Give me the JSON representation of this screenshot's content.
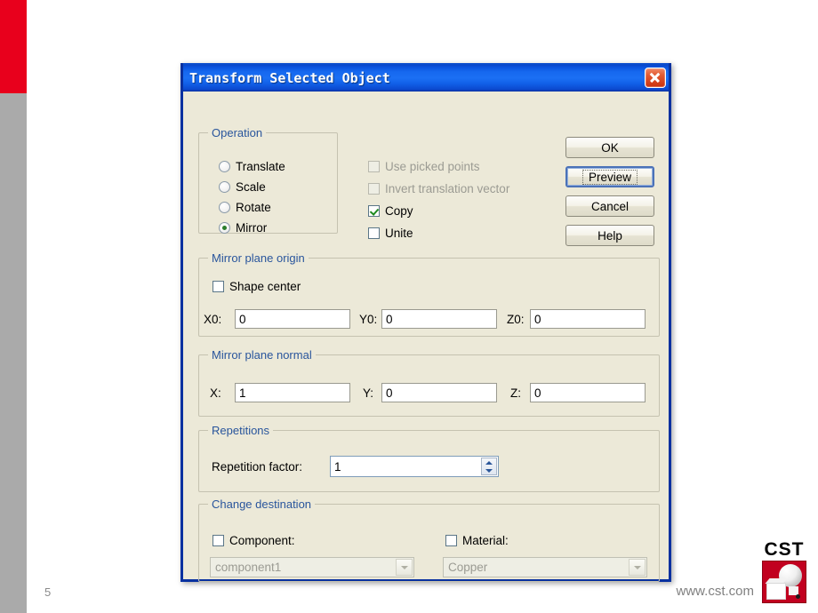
{
  "slide": {
    "page_number": "5",
    "url": "www.cst.com",
    "logo_word": "CST",
    "accent_red": "#e8001c",
    "accent_grey": "#aaaaaa"
  },
  "dialog": {
    "title": "Transform Selected Object",
    "close_label": "×",
    "titlebar_color": "#1b6ff4",
    "face_color": "#ece9d8",
    "group_label_color": "#29559c",
    "groups": {
      "operation": {
        "title": "Operation",
        "radios": [
          {
            "label": "Translate",
            "checked": false
          },
          {
            "label": "Scale",
            "checked": false
          },
          {
            "label": "Rotate",
            "checked": false
          },
          {
            "label": "Mirror",
            "checked": true
          }
        ]
      },
      "options": {
        "checkboxes": [
          {
            "label": "Use picked points",
            "checked": false,
            "disabled": true
          },
          {
            "label": "Invert translation vector",
            "checked": false,
            "disabled": true
          },
          {
            "label": "Copy",
            "checked": true,
            "disabled": false
          },
          {
            "label": "Unite",
            "checked": false,
            "disabled": false
          }
        ]
      },
      "mirror_plane_origin": {
        "title": "Mirror plane origin",
        "shape_center": {
          "label": "Shape center",
          "checked": false
        },
        "fields": [
          {
            "label": "X0:",
            "value": "0"
          },
          {
            "label": "Y0:",
            "value": "0"
          },
          {
            "label": "Z0:",
            "value": "0"
          }
        ]
      },
      "mirror_plane_normal": {
        "title": "Mirror plane normal",
        "fields": [
          {
            "label": "X:",
            "value": "1"
          },
          {
            "label": "Y:",
            "value": "0"
          },
          {
            "label": "Z:",
            "value": "0"
          }
        ]
      },
      "repetitions": {
        "title": "Repetitions",
        "factor_label": "Repetition factor:",
        "factor_value": "1"
      },
      "change_destination": {
        "title": "Change destination",
        "component": {
          "label": "Component:",
          "checked": false,
          "value": "component1",
          "disabled": true
        },
        "material": {
          "label": "Material:",
          "checked": false,
          "value": "Copper",
          "disabled": true
        }
      }
    },
    "buttons": [
      {
        "label": "OK",
        "focused": false
      },
      {
        "label": "Preview",
        "focused": true
      },
      {
        "label": "Cancel",
        "focused": false
      },
      {
        "label": "Help",
        "focused": false
      }
    ]
  }
}
